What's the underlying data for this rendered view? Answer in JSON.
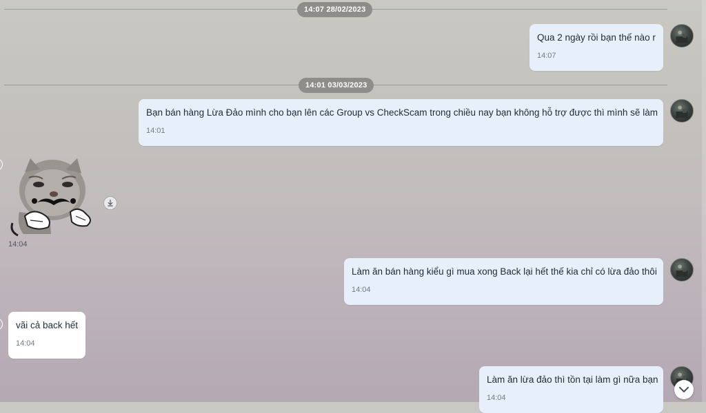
{
  "dividers": [
    {
      "label": "14:07 28/02/2023"
    },
    {
      "label": "14:01 03/03/2023"
    }
  ],
  "messages": [
    {
      "direction": "outgoing",
      "text": "Qua 2 ngày rồi bạn thế nào r",
      "time": "14:07"
    },
    {
      "direction": "outgoing",
      "text": "Bạn bán hàng Lừa Đảo mình cho bạn lên các Group vs CheckScam trong chiều nay bạn không hỗ trợ được thì mình sẽ làm",
      "time": "14:01"
    },
    {
      "direction": "incoming",
      "type": "sticker",
      "sticker": "cat-mustache-sticker",
      "time": "14:04"
    },
    {
      "direction": "outgoing",
      "text": "Làm ăn bán hàng kiểu gì mua xong Back lại hết thế kia chỉ có lừa đảo thôi",
      "time": "14:04"
    },
    {
      "direction": "incoming",
      "text": "vãi cả back hết",
      "time": "14:04"
    },
    {
      "direction": "outgoing",
      "text": "Làm ăn lừa đảo thì tồn tại làm gì nữa bạn",
      "time": "14:04"
    }
  ],
  "icons": {
    "download": "download-icon",
    "scroll_down": "chevron-down-icon"
  },
  "colors": {
    "outgoing_bubble": "#e7effb",
    "incoming_bubble": "#ffffff",
    "date_pill": "#8f8d8a"
  }
}
